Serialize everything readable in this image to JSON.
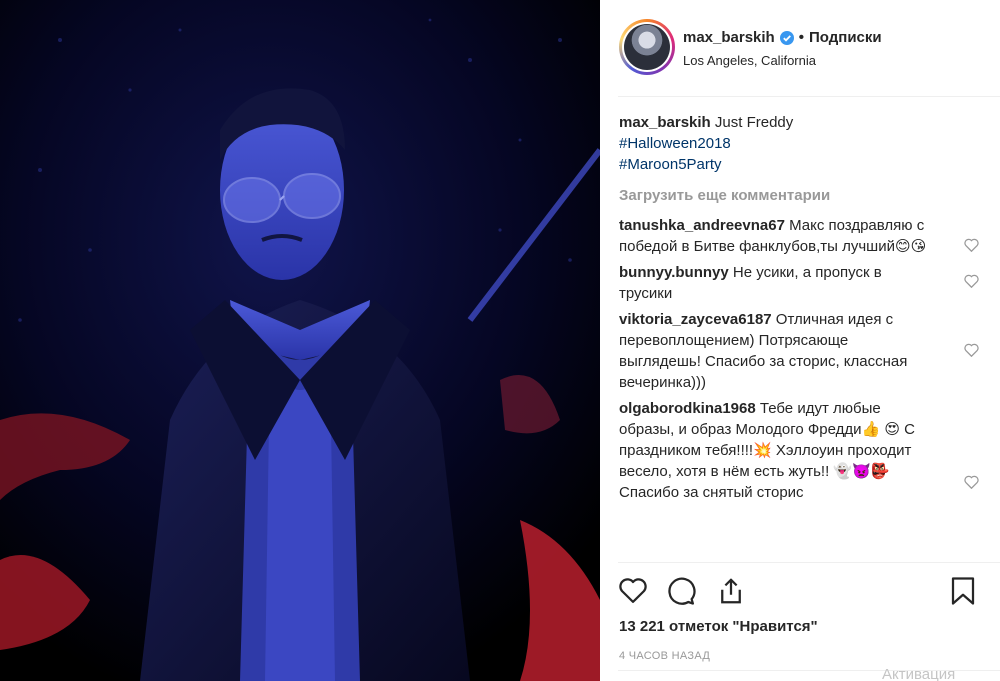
{
  "post": {
    "username": "max_barskih",
    "separator": "•",
    "follow_label": "Подписки",
    "location": "Los Angeles, California"
  },
  "caption": {
    "username": "max_barskih",
    "text": "Just Freddy",
    "hashtags": [
      "#Halloween2018",
      "#Maroon5Party"
    ]
  },
  "load_more_label": "Загрузить еще комментарии",
  "comments": [
    {
      "username": "tanushka_andreevna67",
      "text": "Макс поздравляю с победой в Битве фанклубов,ты лучший😊😘"
    },
    {
      "username": "bunnyy.bunnyy",
      "text": "Не усики, а пропуск в трусики"
    },
    {
      "username": "viktoria_zayceva6187",
      "text": "Отличная идея с перевоплощением) Потрясающе выглядешь! Спасибо за сторис, классная вечеринка)))"
    },
    {
      "username": "olgaborodkina1968",
      "text": "Тебе идут любые образы, и образ Молодого Фредди👍 😍 С праздником тебя!!!!💥 Хэллоуин проходит весело, хотя в нём есть жуть!! 👻👿👺 Спасибо за снятый сторис"
    }
  ],
  "likes_label": "13 221 отметок \"Нравится\"",
  "time_label": "4 ЧАСОВ НАЗАД",
  "watermark": "Активация",
  "icons": {
    "like": "heart-icon",
    "comment": "speech-bubble-icon",
    "share": "share-icon",
    "save": "bookmark-icon",
    "verified": "verified-badge-icon"
  },
  "colors": {
    "verified": "#3897f0",
    "hashtag": "#003569",
    "muted": "#999999",
    "text": "#262626"
  }
}
